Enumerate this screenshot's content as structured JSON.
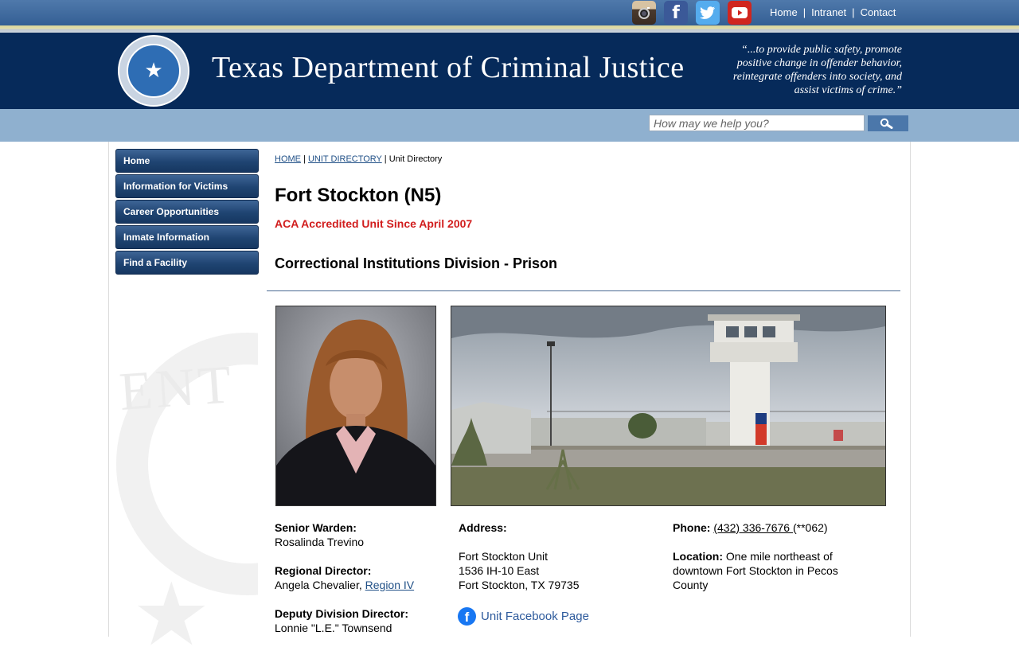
{
  "top_nav": {
    "social": [
      "instagram-icon",
      "facebook-icon",
      "twitter-icon",
      "youtube-icon"
    ],
    "links": [
      "Home",
      "Intranet",
      "Contact"
    ]
  },
  "header": {
    "site_title": "Texas Department of Criminal Justice",
    "mission_lines": [
      "“...to provide public safety, promote",
      "positive change in offender behavior,",
      "reintegrate offenders into society, and",
      "assist victims of crime.”"
    ]
  },
  "search": {
    "placeholder": "How may we help you?"
  },
  "sidebar": {
    "items": [
      {
        "label": "Home"
      },
      {
        "label": "Information for Victims"
      },
      {
        "label": "Career Opportunities"
      },
      {
        "label": "Inmate Information"
      },
      {
        "label": "Find a Facility"
      }
    ]
  },
  "breadcrumb": {
    "home": "HOME",
    "unit_directory": "UNIT DIRECTORY",
    "current": "Unit Directory"
  },
  "page": {
    "title": "Fort Stockton (N5)",
    "accreditation": "ACA Accredited Unit Since April 2007",
    "division": "Correctional Institutions Division - Prison"
  },
  "staff": {
    "senior_warden_label": "Senior Warden:",
    "senior_warden_name": "Rosalinda Trevino",
    "regional_director_label": "Regional Director:",
    "regional_director_name": "Angela Chevalier,",
    "region_link": "Region IV",
    "deputy_director_label": "Deputy Division Director:",
    "deputy_director_name": "Lonnie \"L.E.\" Townsend"
  },
  "address": {
    "label": "Address:",
    "line1": "Fort Stockton Unit",
    "line2": "1536 IH-10 East",
    "line3": "Fort Stockton, TX 79735",
    "facebook_link": "Unit Facebook Page"
  },
  "contact": {
    "phone_label": "Phone:",
    "phone": "(432) 336-7676 ",
    "phone_ext": "(**062)",
    "location_label": "Location:",
    "location_line1": "One mile northeast of",
    "location_line2": "downtown Fort Stockton in Pecos",
    "location_line3": "County"
  },
  "colors": {
    "header_navy": "#062a5a",
    "accent_red": "#d11d1d",
    "search_band": "#8fb0cf"
  }
}
